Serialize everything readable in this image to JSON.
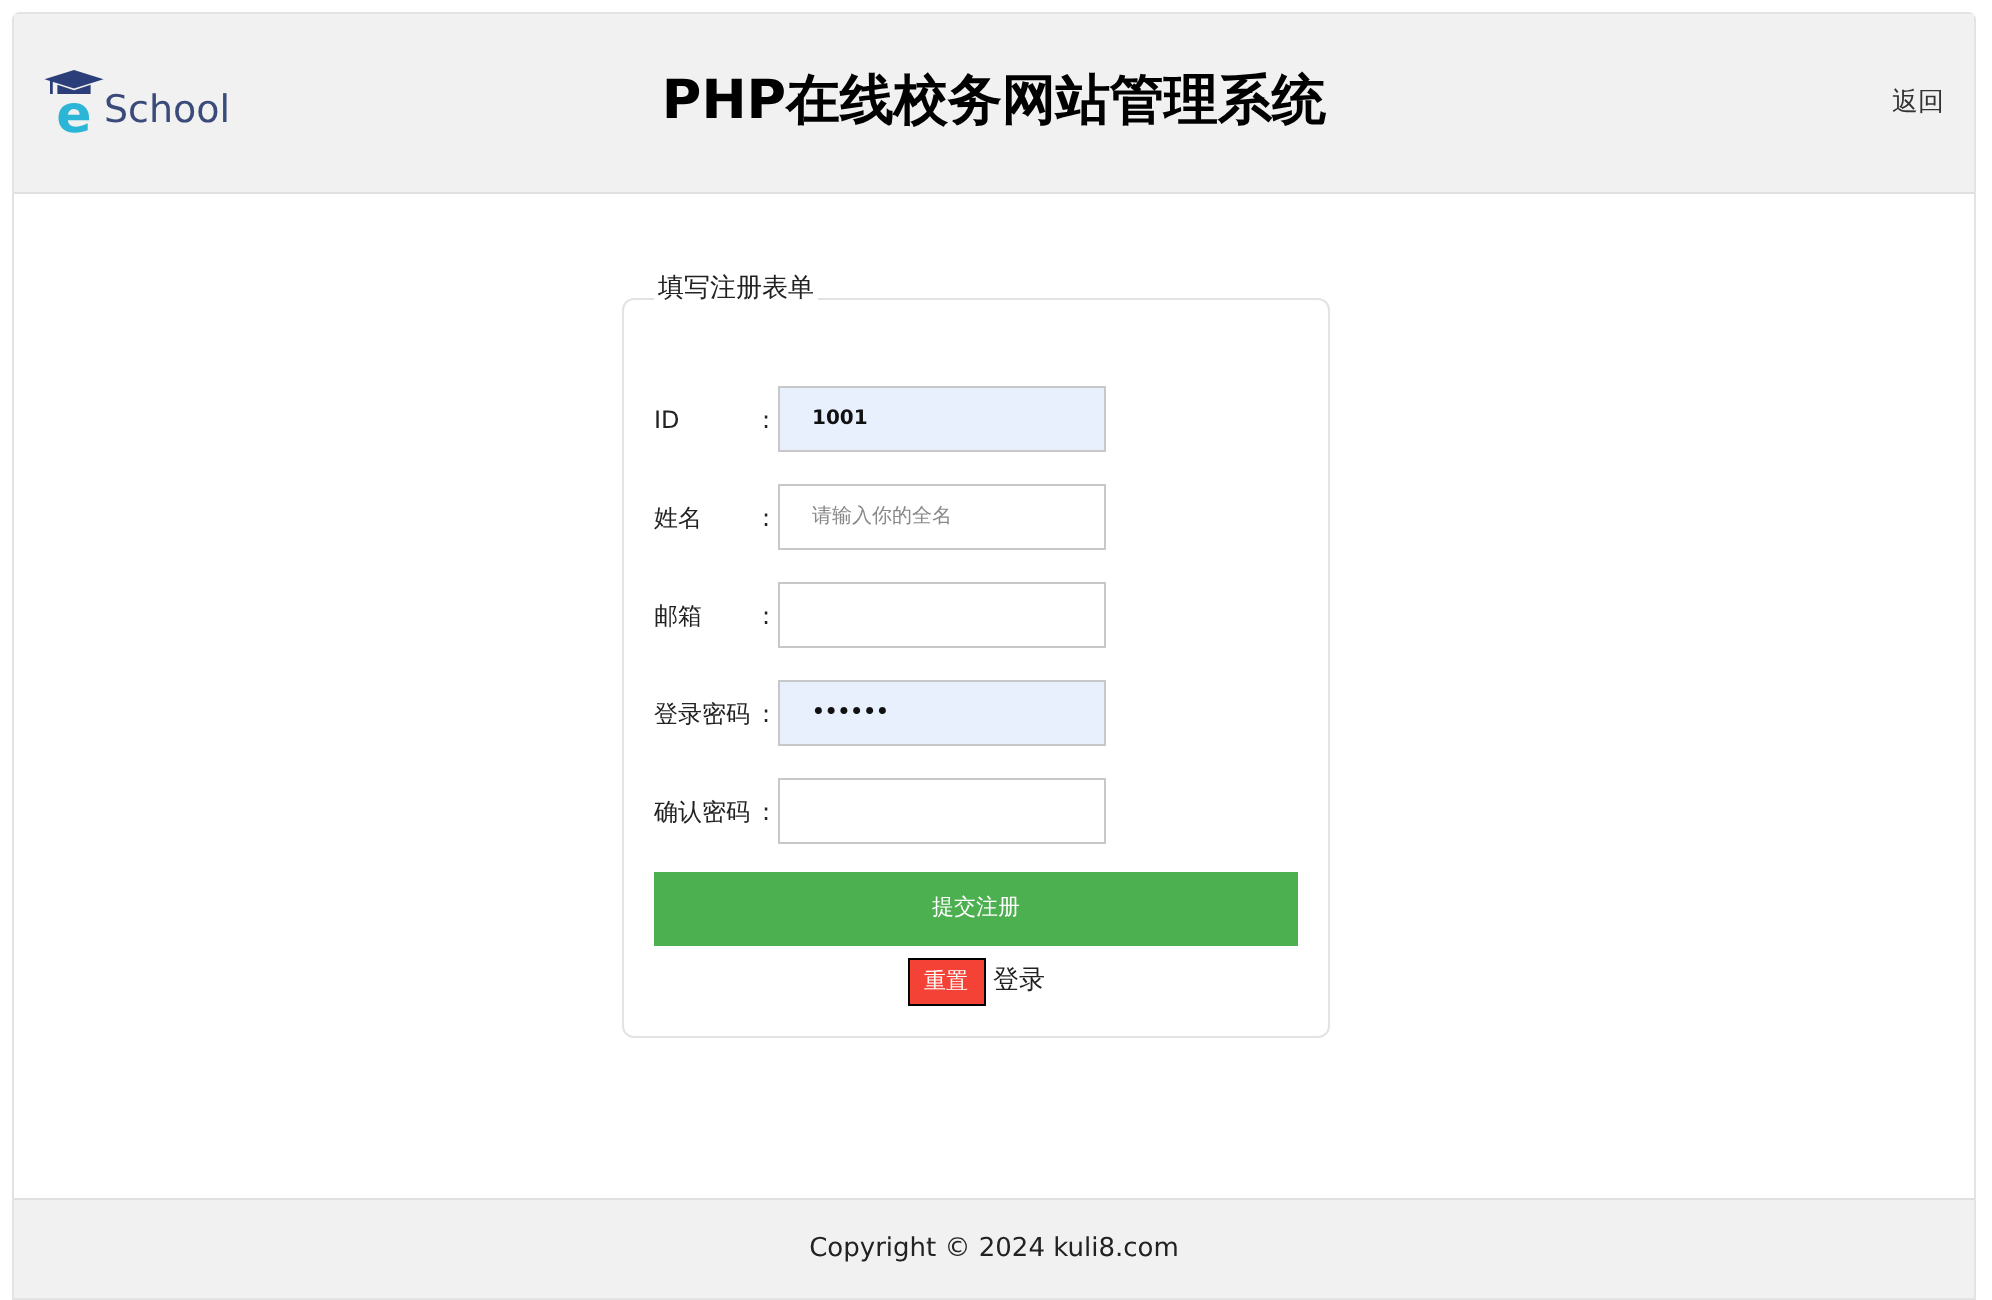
{
  "header": {
    "logo": {
      "mark": "e",
      "name": "School"
    },
    "title": "PHP在线校务网站管理系统",
    "back_link": "返回"
  },
  "form": {
    "legend": "填写注册表单",
    "fields": [
      {
        "label": "ID",
        "colon": ":",
        "value": "1001",
        "autofilled": true
      },
      {
        "label": "姓名",
        "colon": ":",
        "placeholder": "请输入你的全名",
        "autofilled": false
      },
      {
        "label": "邮箱",
        "colon": ":",
        "autofilled": false
      },
      {
        "label": "登录密码",
        "colon": ":",
        "value": "••••••",
        "autofilled": true
      },
      {
        "label": "确认密码",
        "colon": ":",
        "autofilled": false
      }
    ],
    "submit": "提交注册",
    "reset": "重置",
    "login_link": "登录"
  },
  "footer": {
    "copyright": "Copyright © 2024 kuli8.com"
  }
}
